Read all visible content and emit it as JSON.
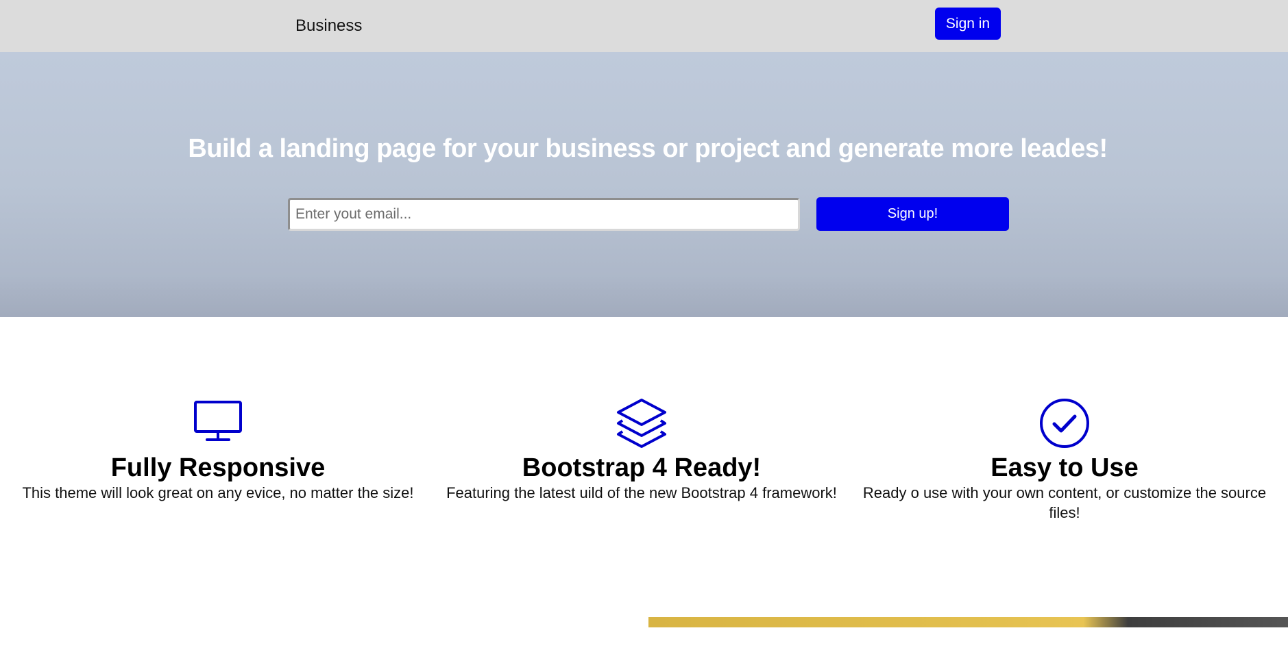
{
  "navbar": {
    "brand": "Business",
    "signin_label": "Sign in"
  },
  "hero": {
    "title": "Build a landing page for your business or project and generate more leades!",
    "email_placeholder": "Enter yout email...",
    "signup_label": "Sign up!"
  },
  "features": [
    {
      "icon": "monitor-icon",
      "title": "Fully Responsive",
      "text": "This theme will look great on any evice, no matter the size!"
    },
    {
      "icon": "layers-icon",
      "title": "Bootstrap 4 Ready!",
      "text": "Featuring the latest uild of the new Bootstrap 4 framework!"
    },
    {
      "icon": "check-circle-icon",
      "title": "Easy to Use",
      "text": "Ready o use with your own content, or customize the source files!"
    }
  ],
  "colors": {
    "accent": "#0000ee",
    "navbar_bg": "#dcdcdc",
    "hero_bg": "#bfcadb"
  }
}
